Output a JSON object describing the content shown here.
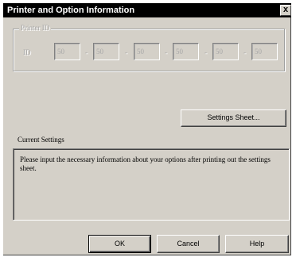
{
  "window": {
    "title": "Printer and Option Information",
    "close_glyph": "x"
  },
  "printer_id": {
    "group_label": "Printer ID",
    "field_label": "ID",
    "fields": [
      "50",
      "50",
      "50",
      "50",
      "50",
      "50"
    ],
    "separator": "-"
  },
  "settings_sheet_button": "Settings Sheet...",
  "current_settings": {
    "label": "Current Settings",
    "text": "Please input the necessary information about your options after printing out the settings sheet."
  },
  "buttons": {
    "ok": "OK",
    "cancel": "Cancel",
    "help": "Help"
  }
}
